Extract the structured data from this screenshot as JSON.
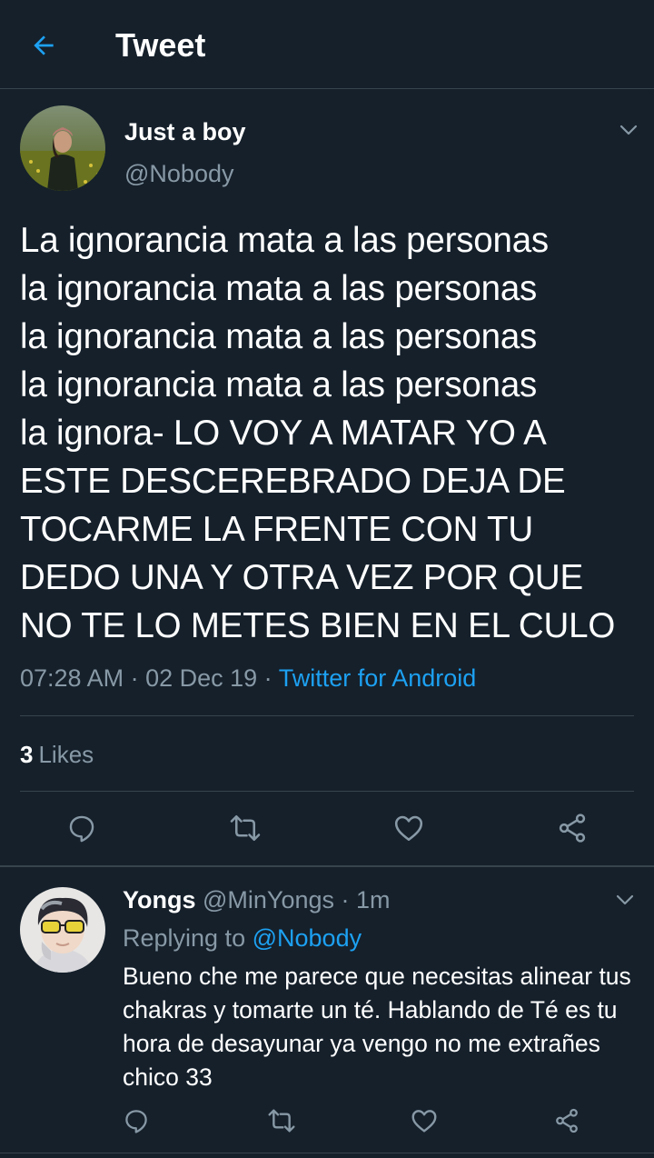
{
  "header": {
    "title": "Tweet",
    "back_icon": "arrow-left-icon",
    "accent": "#1da1f2"
  },
  "tweet": {
    "author_name": "Just a boy",
    "author_handle": "@Nobody",
    "text": "La ignorancia mata a las personas\nla ignorancia mata a las personas\nla ignorancia mata a las personas\nla ignorancia mata a las personas\nla ignora- LO VOY A MATAR YO A\nESTE DESCEREBRADO DEJA DE\nTOCARME LA FRENTE CON TU\nDEDO UNA Y OTRA VEZ POR QUE\nNO TE LO METES BIEN EN EL CULO",
    "time": "07:28 AM",
    "date": "02 Dec 19",
    "source": "Twitter for Android",
    "likes_count": "3",
    "likes_label": "Likes",
    "actions": [
      "reply-icon",
      "retweet-icon",
      "like-icon",
      "share-icon"
    ]
  },
  "reply": {
    "author_name": "Yongs",
    "author_handle": "@MinYongs",
    "time": "1m",
    "replying_label": "Replying to",
    "replying_to": "@Nobody",
    "text": "Bueno che me parece que necesitas alinear tus chakras y tomarte un té. Hablando de Té es tu hora de desayunar ya vengo no me extrañes chico 33",
    "actions": [
      "reply-icon",
      "retweet-icon",
      "like-icon",
      "share-icon"
    ]
  },
  "colors": {
    "background": "#15202b",
    "muted_text": "#8899a6",
    "divider": "#38444d",
    "link": "#1da1f2"
  }
}
